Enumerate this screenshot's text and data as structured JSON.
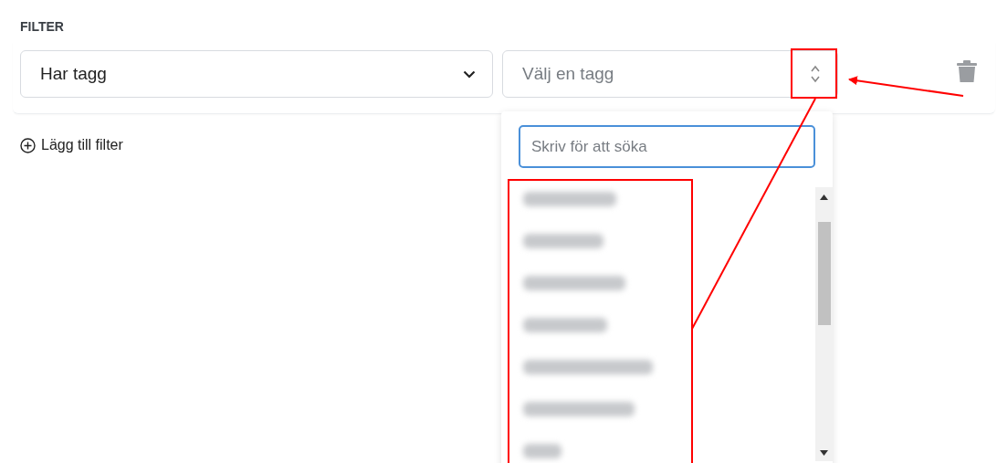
{
  "section_label": "FILTER",
  "filter": {
    "condition": "Har tagg",
    "tag_select": {
      "placeholder": "Välj en tagg",
      "expanded": true
    }
  },
  "add_filter": "Lägg till filter",
  "dropdown": {
    "search": {
      "placeholder": "Skriv för att söka"
    },
    "options": [
      {
        "kind": "blurred"
      },
      {
        "kind": "blurred"
      },
      {
        "kind": "blurred"
      },
      {
        "kind": "blurred"
      },
      {
        "kind": "blurred"
      },
      {
        "kind": "blurred"
      },
      {
        "kind": "blurred"
      }
    ]
  }
}
